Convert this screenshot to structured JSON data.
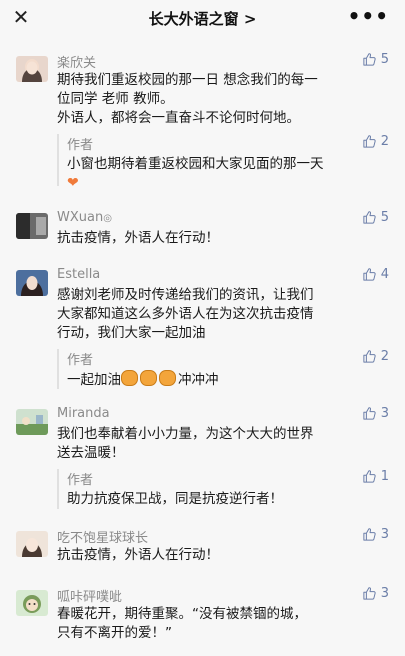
{
  "topbar": {
    "close_icon": "close-icon",
    "title": "长大外语之窗 >",
    "more": "•••"
  },
  "comments": [
    {
      "name": "楽欣关",
      "likes": "5",
      "text_line1": "期待我们重返校园的那一日 想念我们的每一",
      "text_line2": "位同学 老师 教师。",
      "text_line3": "外语人，都将会一直奋斗不论何时何地。",
      "reply": {
        "author": "作者",
        "likes": "2",
        "text": "小窗也期待着重返校园和大家见面的那一天"
      }
    },
    {
      "name": "WXuan",
      "name_suffix": "◎",
      "likes": "5",
      "text_line1": "抗击疫情，外语人在行动！"
    },
    {
      "name": "Estella",
      "likes": "4",
      "text_line1": "感谢刘老师及时传递给我们的资讯，让我们",
      "text_line2": "大家都知道这么多外语人在为这次抗击疫情",
      "text_line3": "行动，我们大家一起加油",
      "reply": {
        "author": "作者",
        "likes": "2",
        "text_prefix": "一起加油",
        "text_suffix": "冲冲冲"
      }
    },
    {
      "name": "Miranda",
      "likes": "3",
      "text_line1": "我们也奉献着小小力量，为这个大大的世界",
      "text_line2": "送去温暖！",
      "reply": {
        "author": "作者",
        "likes": "1",
        "text": "助力抗疫保卫战，同是抗疫逆行者！"
      }
    },
    {
      "name": "吃不饱星球球长",
      "likes": "3",
      "text_line1": "抗击疫情，外语人在行动！"
    },
    {
      "name": "呱咔砰噗呲",
      "likes": "3",
      "text_line1": "春暖花开，期待重聚。“没有被禁锢的城，",
      "text_line2": "只有不离开的爱！”"
    }
  ],
  "colors": {
    "background": "#f7f7f7",
    "like_blue": "#6b7ea8",
    "meta_gray": "#8a8a8a"
  }
}
